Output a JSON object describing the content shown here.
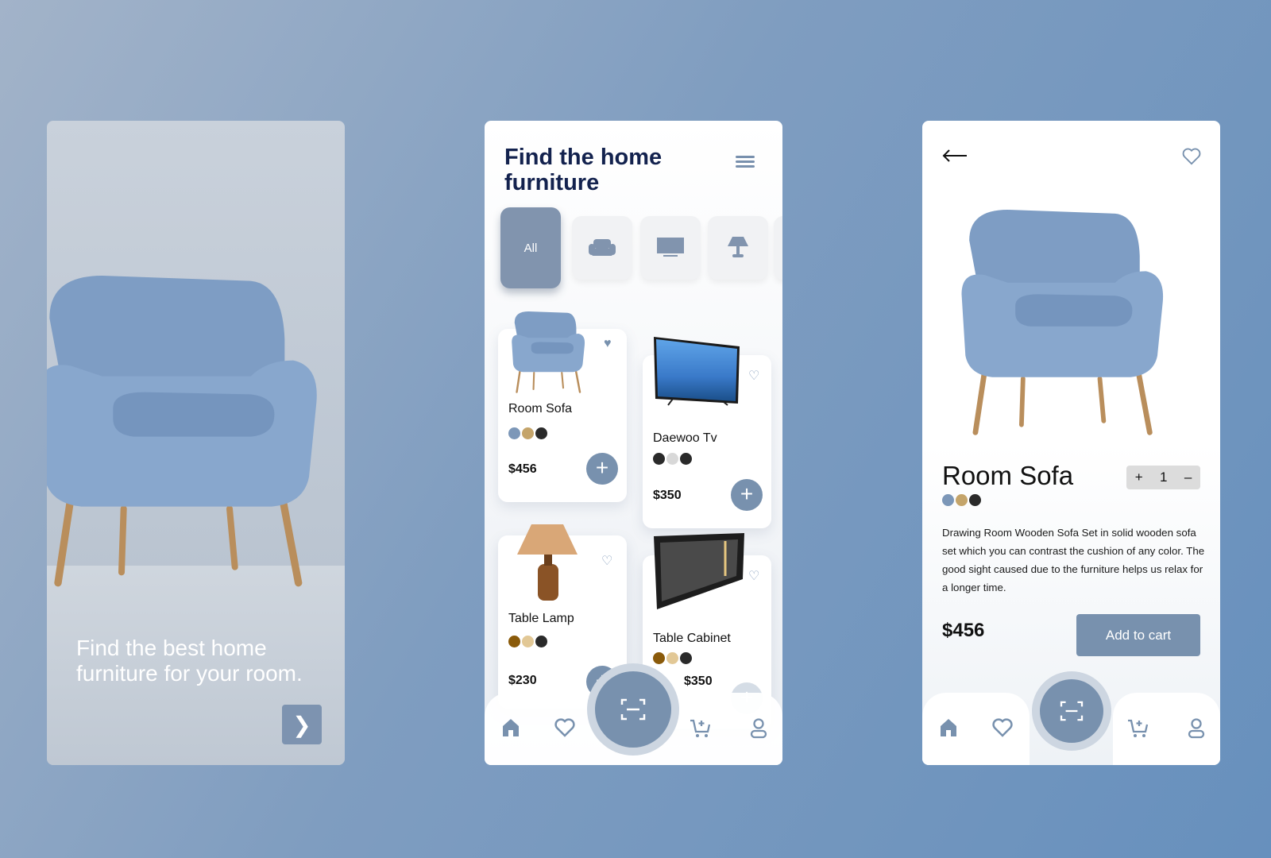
{
  "onboarding": {
    "headline": "Find the best home furniture for your room.",
    "next_icon": "chevron-right-icon"
  },
  "catalog": {
    "title": "Find the home furniture",
    "categories": [
      {
        "label": "All",
        "active": true
      },
      {
        "icon": "armchair-icon"
      },
      {
        "icon": "tv-icon"
      },
      {
        "icon": "lamp-icon"
      }
    ],
    "products": [
      {
        "name": "Room Sofa",
        "price": "$456",
        "colors": [
          "#7c97b8",
          "#c4a46a",
          "#2a2a2a"
        ],
        "favorite": true
      },
      {
        "name": "Daewoo Tv",
        "price": "$350",
        "colors": [
          "#2a2a2a",
          "#d8d8d8",
          "#2a2a2a"
        ],
        "favorite": false
      },
      {
        "name": "Table Lamp",
        "price": "$230",
        "colors": [
          "#8a5a0a",
          "#e2c896",
          "#2a2a2a"
        ],
        "favorite": false
      },
      {
        "name": "Table Cabinet",
        "price": "$350",
        "colors": [
          "#8a5a0a",
          "#e2c896",
          "#2a2a2a"
        ],
        "favorite": false
      }
    ]
  },
  "detail": {
    "name": "Room Sofa",
    "quantity": "1",
    "colors": [
      "#7c97b8",
      "#c4a46a",
      "#2a2a2a"
    ],
    "description": "Drawing Room Wooden Sofa Set in solid wooden sofa set which you can contrast the cushion of any color. The good sight caused due to the furniture helps us relax for a longer time.",
    "price": "$456",
    "add_to_cart": "Add to cart"
  },
  "nav": [
    "home-icon",
    "heart-icon",
    "scan-icon",
    "cart-icon",
    "user-icon"
  ],
  "accent": "#7891ae",
  "title_color": "#13224e"
}
